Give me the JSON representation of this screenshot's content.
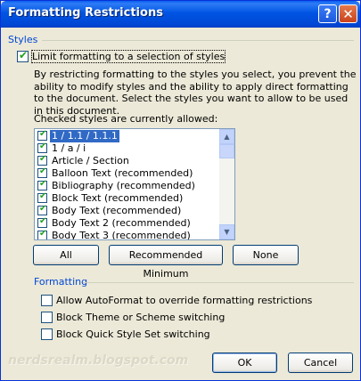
{
  "window": {
    "title": "Formatting Restrictions",
    "help_glyph": "?",
    "close_glyph": "✕"
  },
  "styles_group": {
    "label": "Styles",
    "limit_checkbox": {
      "label": "Limit formatting to a selection of styles",
      "checked": true
    },
    "description": "By restricting formatting to the styles you select, you prevent the ability to modify styles and the ability to apply direct formatting to the document. Select the styles you want to allow to be used in this document.",
    "list_caption": "Checked styles are currently allowed:",
    "styles": [
      {
        "label": "1 / 1.1 / 1.1.1",
        "checked": true,
        "selected": true
      },
      {
        "label": "1 / a / i",
        "checked": true
      },
      {
        "label": "Article / Section",
        "checked": true
      },
      {
        "label": "Balloon Text (recommended)",
        "checked": true
      },
      {
        "label": "Bibliography (recommended)",
        "checked": true
      },
      {
        "label": "Block Text (recommended)",
        "checked": true
      },
      {
        "label": "Body Text (recommended)",
        "checked": true
      },
      {
        "label": "Body Text 2 (recommended)",
        "checked": true
      },
      {
        "label": "Body Text 3 (recommended)",
        "checked": true
      }
    ],
    "buttons": {
      "all": "All",
      "recommended": "Recommended Minimum",
      "none": "None"
    }
  },
  "formatting_group": {
    "label": "Formatting",
    "options": [
      {
        "label": "Allow AutoFormat to override formatting restrictions",
        "checked": false
      },
      {
        "label": "Block Theme or Scheme switching",
        "checked": false
      },
      {
        "label": "Block Quick Style Set switching",
        "checked": false
      }
    ]
  },
  "footer": {
    "ok": "OK",
    "cancel": "Cancel",
    "watermark": "nerdsrealm.blogspot.com"
  },
  "colors": {
    "titlebar": "#0054e3",
    "dialog_bg": "#ece9d8",
    "group_label": "#0046d5",
    "selection": "#316ac5",
    "check": "#21a121"
  }
}
